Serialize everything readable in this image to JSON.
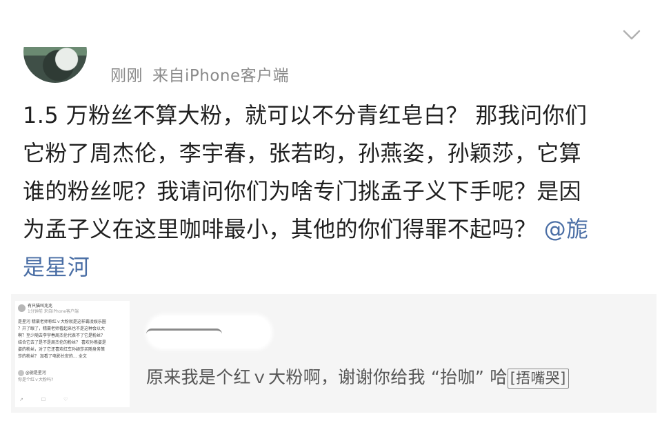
{
  "post": {
    "meta_time": "刚刚",
    "meta_source": "来自iPhone客户端",
    "lines": [
      "1.5 万粉丝不算大粉，就可以不分青红皂白？  那我问你们",
      "它粉了周杰伦，李宇春，张若昀，孙燕姿，孙颖莎，它算",
      "谁的粉丝呢？我请问你们为啥专门挑孟子义下手呢？是因",
      "为孟子义在这里咖啡最小，其他的你们得罪不起吗？"
    ],
    "mention_part1": "@旎",
    "mention_part2": "是星河"
  },
  "repost": {
    "reply_text": "原来我是个红ｖ大粉啊，谢谢你给我 “抬咖” 哈",
    "reply_emoji": "[捂嘴哭]",
    "thumbnail": {
      "name": "有只猫叫兆兆",
      "time": "1分钟前 来自iPhone客户端",
      "body_lines": [
        "是星河  精粟老师称红ｖ大粉就是这样霸凌娱乐圈",
        "？开了眼了，精粟老师看起来也不是这种会以大",
        "啊？至少随去李宇春周杰伦代表不了它是粉丝？",
        "结合它去了是不是周杰伦的粉丝？ 喜欢孙燕姿是",
        "姿的粉丝，对了它还喜欢红车孙颖莎买随身务策",
        "莎的粉丝？ 加看了电影长安的… 全文"
      ],
      "body_link": "是星河",
      "sub_name": "@旎是星河",
      "sub_text": "你是个红ｖ大粉吗?",
      "actions": [
        "↗",
        "☐",
        "♡"
      ]
    }
  },
  "colors": {
    "mention": "#4a6ea5",
    "meta": "#8a8a8a"
  },
  "icons": {
    "collapse": "chevron-down-icon"
  }
}
